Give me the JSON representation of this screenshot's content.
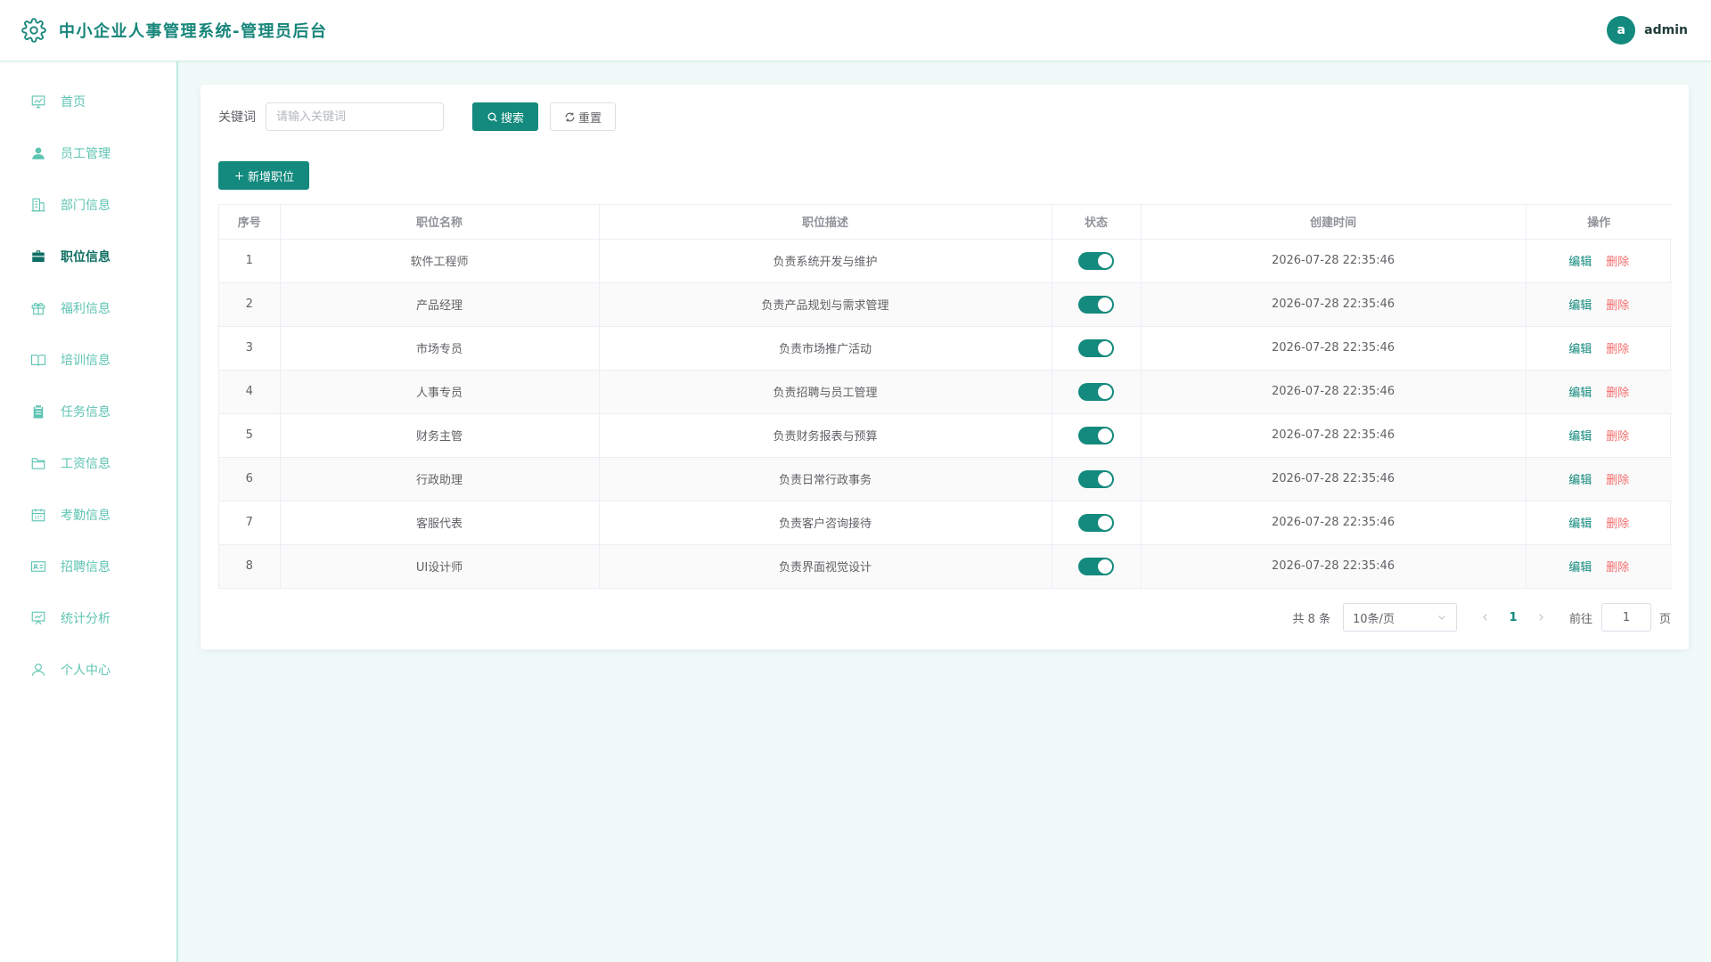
{
  "header": {
    "title": "中小企业人事管理系统-管理员后台",
    "avatar_letter": "a",
    "username": "admin"
  },
  "sidebar": {
    "items": [
      {
        "label": "首页",
        "icon": "dashboard-icon",
        "active": false
      },
      {
        "label": "员工管理",
        "icon": "user-icon",
        "active": false
      },
      {
        "label": "部门信息",
        "icon": "building-icon",
        "active": false
      },
      {
        "label": "职位信息",
        "icon": "briefcase-icon",
        "active": true
      },
      {
        "label": "福利信息",
        "icon": "gift-icon",
        "active": false
      },
      {
        "label": "培训信息",
        "icon": "book-icon",
        "active": false
      },
      {
        "label": "任务信息",
        "icon": "clipboard-icon",
        "active": false
      },
      {
        "label": "工资信息",
        "icon": "folder-icon",
        "active": false
      },
      {
        "label": "考勤信息",
        "icon": "calendar-icon",
        "active": false
      },
      {
        "label": "招聘信息",
        "icon": "id-card-icon",
        "active": false
      },
      {
        "label": "统计分析",
        "icon": "presentation-chart-icon",
        "active": false
      },
      {
        "label": "个人中心",
        "icon": "person-icon",
        "active": false
      }
    ]
  },
  "search": {
    "label": "关键词",
    "placeholder": "请输入关键词",
    "search_button": "搜索",
    "reset_button": "重置"
  },
  "toolbar": {
    "add_button": "新增职位"
  },
  "table": {
    "columns": [
      "序号",
      "职位名称",
      "职位描述",
      "状态",
      "创建时间",
      "操作"
    ],
    "rows": [
      {
        "index": "1",
        "name": "软件工程师",
        "desc": "负责系统开发与维护",
        "enabled": true,
        "created": "2026-07-28 22:35:46"
      },
      {
        "index": "2",
        "name": "产品经理",
        "desc": "负责产品规划与需求管理",
        "enabled": true,
        "created": "2026-07-28 22:35:46"
      },
      {
        "index": "3",
        "name": "市场专员",
        "desc": "负责市场推广活动",
        "enabled": true,
        "created": "2026-07-28 22:35:46"
      },
      {
        "index": "4",
        "name": "人事专员",
        "desc": "负责招聘与员工管理",
        "enabled": true,
        "created": "2026-07-28 22:35:46"
      },
      {
        "index": "5",
        "name": "财务主管",
        "desc": "负责财务报表与预算",
        "enabled": true,
        "created": "2026-07-28 22:35:46"
      },
      {
        "index": "6",
        "name": "行政助理",
        "desc": "负责日常行政事务",
        "enabled": true,
        "created": "2026-07-28 22:35:46"
      },
      {
        "index": "7",
        "name": "客服代表",
        "desc": "负责客户咨询接待",
        "enabled": true,
        "created": "2026-07-28 22:35:46"
      },
      {
        "index": "8",
        "name": "UI设计师",
        "desc": "负责界面视觉设计",
        "enabled": true,
        "created": "2026-07-28 22:35:46"
      }
    ],
    "edit_label": "编辑",
    "delete_label": "删除"
  },
  "pagination": {
    "total_text": "共 8 条",
    "page_size": "10条/页",
    "current_page": "1",
    "goto_label": "前往",
    "goto_value": "1",
    "page_suffix": "页"
  },
  "colors": {
    "primary": "#138a7d",
    "sidebar_text": "#5ec4b3",
    "danger": "#f56c6c",
    "background": "#f0faf8"
  }
}
